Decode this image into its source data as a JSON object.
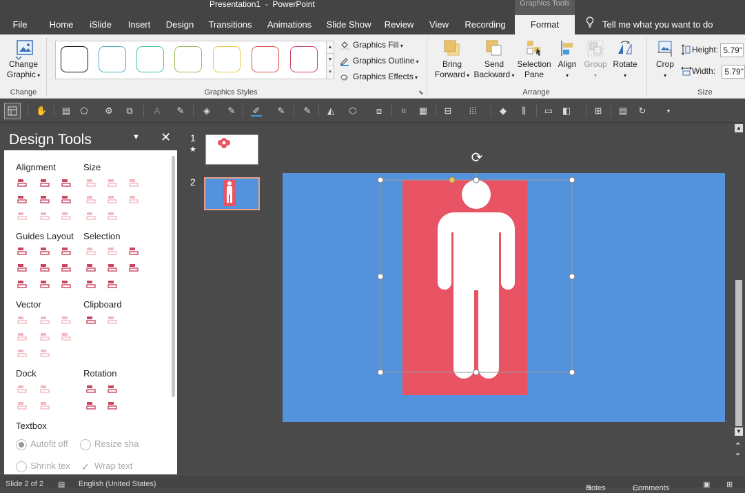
{
  "window": {
    "title": "Presentation1  -  PowerPoint",
    "contextual_group": "Graphics Tools"
  },
  "tabs": [
    {
      "label": "File"
    },
    {
      "label": "Home"
    },
    {
      "label": "iSlide"
    },
    {
      "label": "Insert"
    },
    {
      "label": "Design"
    },
    {
      "label": "Transitions"
    },
    {
      "label": "Animations"
    },
    {
      "label": "Slide Show"
    },
    {
      "label": "Review"
    },
    {
      "label": "View"
    },
    {
      "label": "Recording"
    },
    {
      "label": "Format",
      "active": true
    }
  ],
  "tell_me": "Tell me what you want to do",
  "ribbon": {
    "change": {
      "button_line1": "Change",
      "button_line2": "Graphic",
      "group_label": "Change"
    },
    "graphics_styles": {
      "group_label": "Graphics Styles",
      "swatch_colors": [
        "#000000",
        "#4bacc6",
        "#4bbfa3",
        "#9bbb59",
        "#e6c84a",
        "#d9534f",
        "#c9455f"
      ],
      "fill_label": "Graphics Fill",
      "outline_label": "Graphics Outline",
      "effects_label": "Graphics Effects"
    },
    "arrange": {
      "group_label": "Arrange",
      "bring_forward_line1": "Bring",
      "bring_forward_line2": "Forward",
      "send_backward_line1": "Send",
      "send_backward_line2": "Backward",
      "selection_pane_line1": "Selection",
      "selection_pane_line2": "Pane",
      "align_label": "Align",
      "group_btn_label": "Group",
      "rotate_label": "Rotate"
    },
    "size": {
      "group_label": "Size",
      "crop_label": "Crop",
      "height_label": "Height:",
      "height_value": "5.79\"",
      "width_label": "Width:",
      "width_value": "5.79\""
    }
  },
  "design_tools": {
    "title": "Design Tools",
    "sections": {
      "alignment": "Alignment",
      "size": "Size",
      "guides_layout": "Guides Layout",
      "selection": "Selection",
      "vector": "Vector",
      "clipboard": "Clipboard",
      "dock": "Dock",
      "rotation": "Rotation",
      "textbox": "Textbox"
    },
    "textbox_options": {
      "autofit": "Autofit off",
      "resize": "Resize sha",
      "shrink": "Shrink tex",
      "wrap": "Wrap text"
    }
  },
  "thumbnails": [
    {
      "number": "1",
      "has_animation": true
    },
    {
      "number": "2",
      "selected": true
    }
  ],
  "slide": {
    "background_color": "#5592dc",
    "rect_color": "#e85464",
    "figure_color": "#ffffff"
  },
  "status": {
    "slide_info": "Slide 2 of 2",
    "language": "English (United States)",
    "notes": "Notes",
    "comments": "Comments"
  },
  "colors": {
    "accent_red": "#c9455f",
    "icon_light": "#f2b8be",
    "selection_border": "#e8a08a"
  }
}
